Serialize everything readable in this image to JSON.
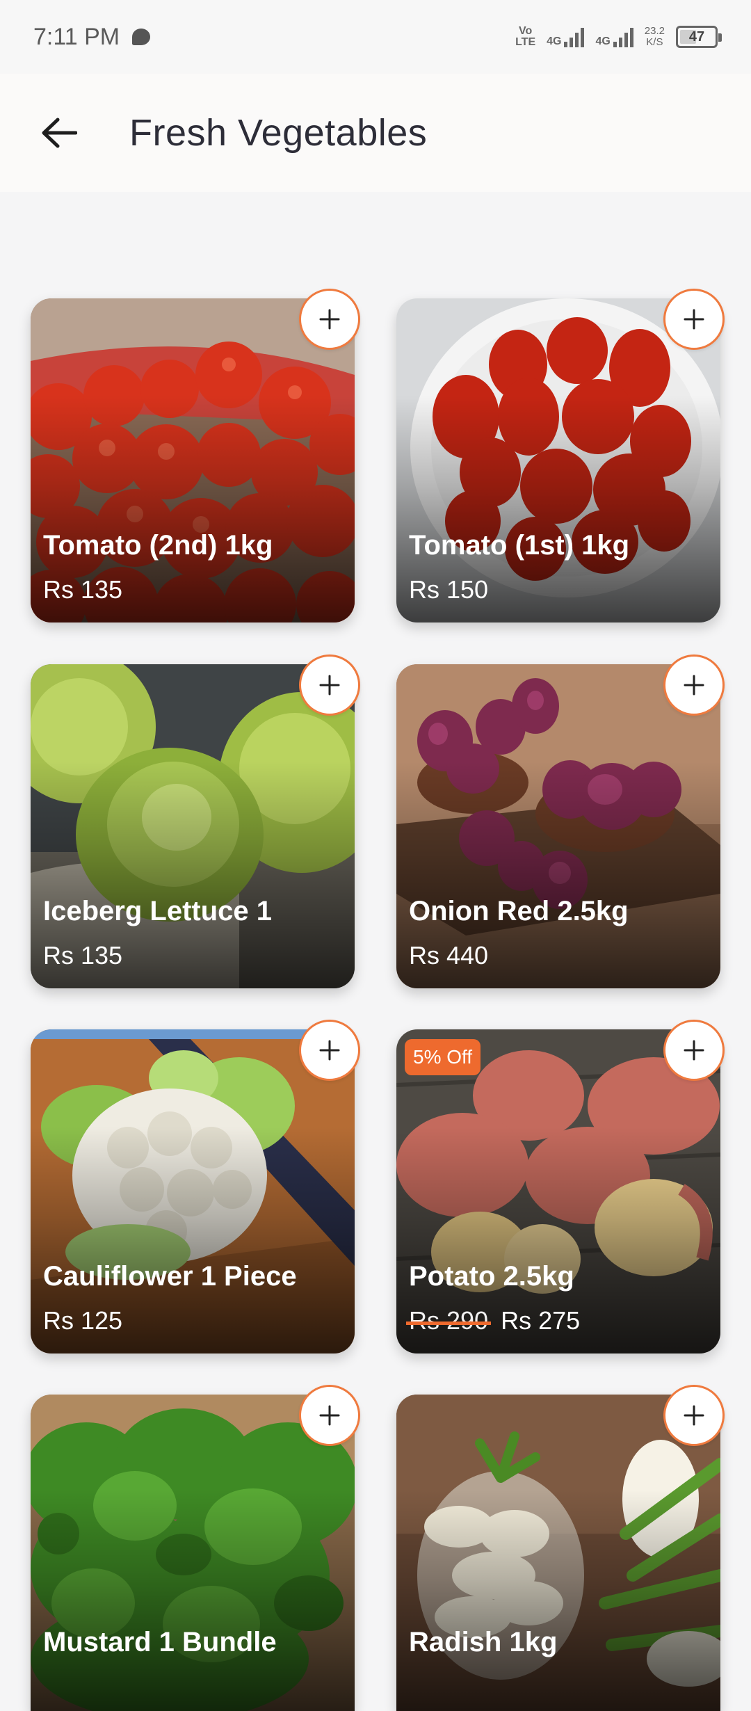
{
  "status_bar": {
    "time": "7:11 PM",
    "net1_top": "Vo",
    "net1_bottom": "LTE",
    "net2": "4G",
    "net3": "4G",
    "speed_value": "23.2",
    "speed_unit": "K/S",
    "battery": "47",
    "battery_level": 0.47
  },
  "header": {
    "back_icon": "arrow-left-icon",
    "title": "Fresh Vegetables"
  },
  "accent_color": "#ee6a2e",
  "products": [
    {
      "name": "Tomato (2nd) 1kg",
      "price": "Rs 135",
      "add_icon": "plus-icon"
    },
    {
      "name": "Tomato (1st) 1kg",
      "price": "Rs 150",
      "add_icon": "plus-icon"
    },
    {
      "name": "Iceberg Lettuce 1",
      "price": "Rs 135",
      "add_icon": "plus-icon"
    },
    {
      "name": "Onion Red 2.5kg",
      "price": "Rs 440",
      "add_icon": "plus-icon"
    },
    {
      "name": "Cauliflower 1 Piece",
      "price": "Rs 125",
      "add_icon": "plus-icon"
    },
    {
      "name": "Potato 2.5kg",
      "old_price": "Rs 290",
      "price": "Rs 275",
      "badge": "5% Off",
      "add_icon": "plus-icon"
    },
    {
      "name": "Mustard 1 Bundle",
      "price": "",
      "add_icon": "plus-icon"
    },
    {
      "name": "Radish 1kg",
      "price": "",
      "add_icon": "plus-icon"
    }
  ]
}
